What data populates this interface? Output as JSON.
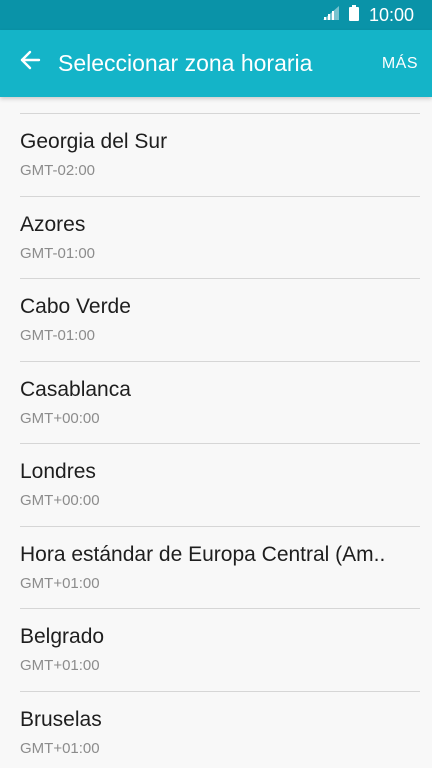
{
  "status_bar": {
    "time": "10:00",
    "signal_icon": "signal-icon",
    "battery_icon": "battery-icon"
  },
  "header": {
    "back_icon": "back-arrow-icon",
    "title": "Seleccionar zona horaria",
    "more_label": "MÁS"
  },
  "timezones": [
    {
      "name": "Georgia del Sur",
      "offset": "GMT-02:00"
    },
    {
      "name": "Azores",
      "offset": "GMT-01:00"
    },
    {
      "name": "Cabo Verde",
      "offset": "GMT-01:00"
    },
    {
      "name": "Casablanca",
      "offset": "GMT+00:00"
    },
    {
      "name": "Londres",
      "offset": "GMT+00:00"
    },
    {
      "name": "Hora estándar de Europa Central (Am..",
      "offset": "GMT+01:00"
    },
    {
      "name": "Belgrado",
      "offset": "GMT+01:00"
    },
    {
      "name": "Bruselas",
      "offset": "GMT+01:00"
    }
  ],
  "colors": {
    "status_bar": "#0a93a8",
    "app_bar": "#14b4c8",
    "background": "#f8f8f8"
  }
}
